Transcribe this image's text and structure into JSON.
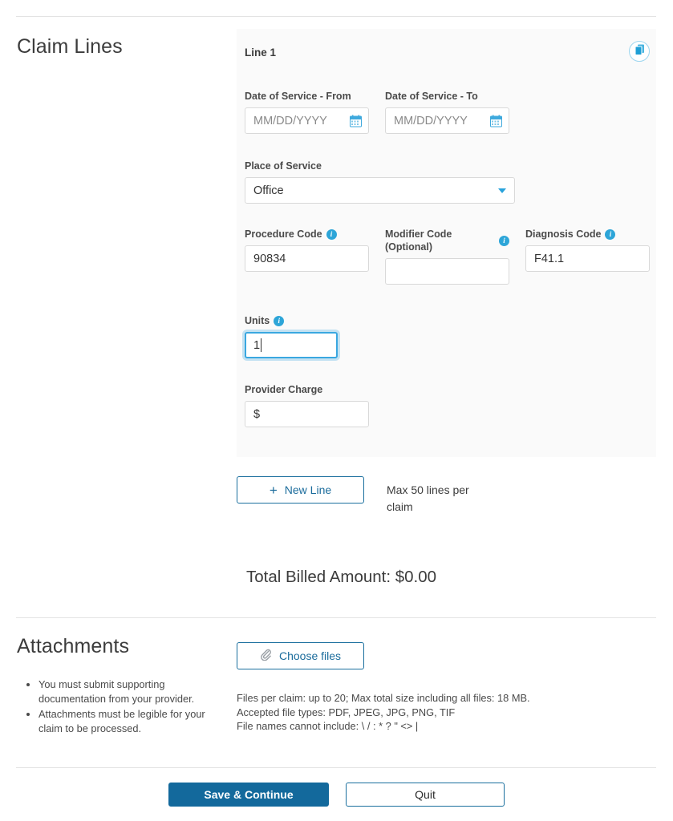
{
  "sections": {
    "claim_lines": {
      "title": "Claim Lines",
      "line": {
        "label": "Line 1",
        "copy_icon": "copy-documents-icon",
        "fields": {
          "dos_from": {
            "label": "Date of Service - From",
            "value": "",
            "placeholder": "MM/DD/YYYY",
            "icon": "calendar-icon"
          },
          "dos_to": {
            "label": "Date of Service - To",
            "value": "",
            "placeholder": "MM/DD/YYYY",
            "icon": "calendar-icon"
          },
          "place_of_service": {
            "label": "Place of Service",
            "value": "Office",
            "icon": "chevron-down-icon"
          },
          "procedure_code": {
            "label": "Procedure Code",
            "value": "90834",
            "info_icon": "info-icon"
          },
          "modifier_code": {
            "label": "Modifier Code (Optional)",
            "value": "",
            "info_icon": "info-icon"
          },
          "diagnosis_code": {
            "label": "Diagnosis Code",
            "value": "F41.1",
            "info_icon": "info-icon"
          },
          "units": {
            "label": "Units",
            "value": "1",
            "info_icon": "info-icon",
            "focused": true
          },
          "provider_charge": {
            "label": "Provider Charge",
            "value": "$"
          }
        }
      },
      "new_line_button": {
        "label": "New Line",
        "icon": "plus-icon"
      },
      "max_lines_note": "Max 50 lines per claim",
      "total_billed": "Total Billed Amount: $0.00"
    },
    "attachments": {
      "title": "Attachments",
      "choose_files_button": {
        "label": "Choose files",
        "icon": "paperclip-icon"
      },
      "bullets": [
        "You must submit supporting documentation from your provider.",
        "Attachments must be legible for your claim to be processed."
      ],
      "rules": [
        "Files per claim: up to 20; Max total size including all files: 18 MB.",
        "Accepted file types: PDF, JPEG, JPG, PNG, TIF",
        "File names cannot include: \\ / : * ? \" <> |"
      ]
    }
  },
  "footer": {
    "save_label": "Save & Continue",
    "quit_label": "Quit"
  },
  "colors": {
    "primary_blue": "#13699c",
    "link_blue": "#1b6c9c",
    "accent_cyan": "#2da5d8",
    "panel_gray": "#fafafa",
    "divider": "#e3e3e3"
  }
}
